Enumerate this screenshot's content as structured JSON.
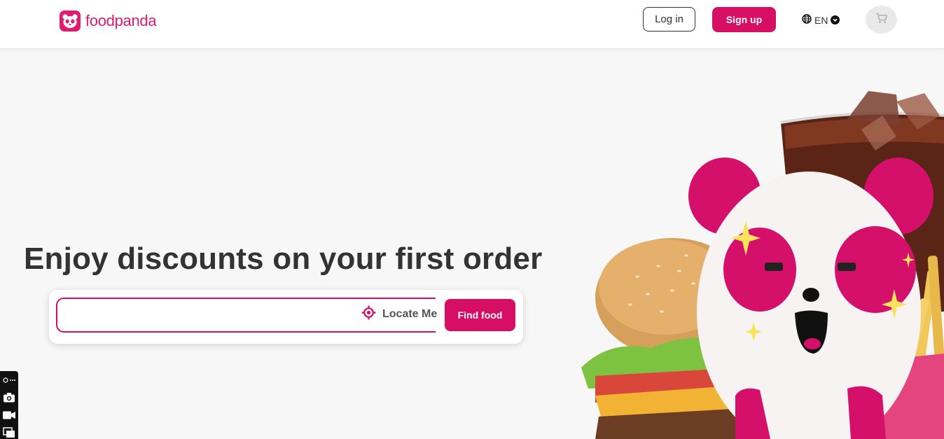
{
  "header": {
    "brand": "foodpanda",
    "login_label": "Log in",
    "signup_label": "Sign up",
    "language": "EN"
  },
  "hero": {
    "headline": "Enjoy discounts on your first order"
  },
  "search": {
    "placeholder": "",
    "value": "",
    "locate_label": "Locate Me",
    "find_label": "Find food"
  },
  "colors": {
    "brand": "#d70f64",
    "text": "#333333",
    "background": "#f7f7f7"
  },
  "icons": {
    "globe": "globe-icon",
    "cart": "cart-icon",
    "locate": "crosshair-icon",
    "logo": "panda-icon"
  }
}
